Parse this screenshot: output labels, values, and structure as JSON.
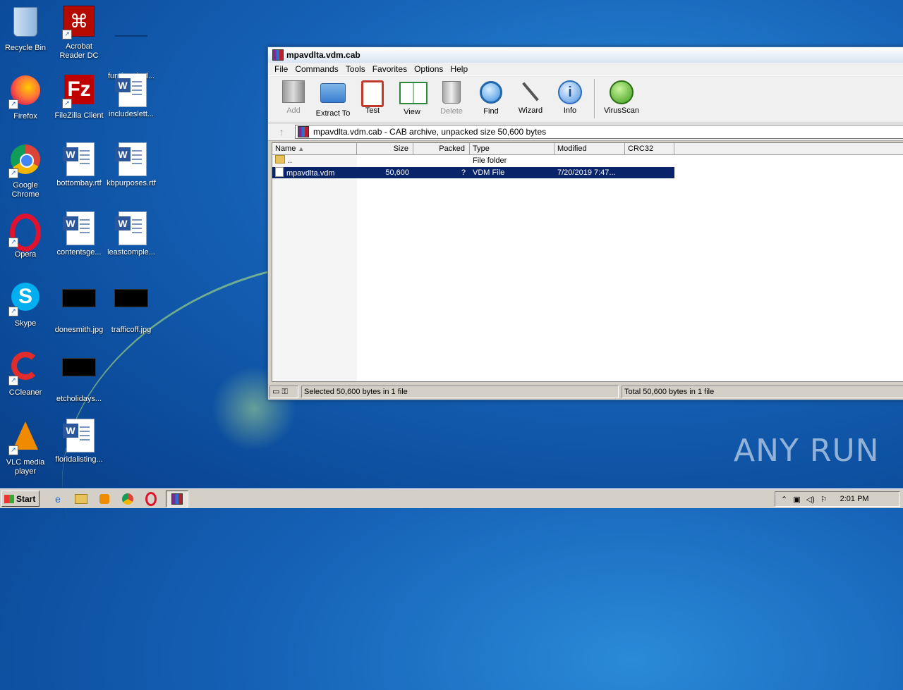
{
  "desktop": {
    "icons": [
      {
        "label": "Recycle Bin"
      },
      {
        "label": "Acrobat Reader DC"
      },
      {
        "label": "furnitureincl..."
      },
      {
        "label": "Firefox"
      },
      {
        "label": "FileZilla Client"
      },
      {
        "label": "includeslett..."
      },
      {
        "label": "Google Chrome"
      },
      {
        "label": "bottombay.rtf"
      },
      {
        "label": "kbpurposes.rtf"
      },
      {
        "label": "Opera"
      },
      {
        "label": "contentsge..."
      },
      {
        "label": "leastcomple..."
      },
      {
        "label": "Skype"
      },
      {
        "label": "donesmith.jpg"
      },
      {
        "label": "trafficoff.jpg"
      },
      {
        "label": "CCleaner"
      },
      {
        "label": "etcholidays..."
      },
      {
        "label": "VLC media player"
      },
      {
        "label": "floridalisting..."
      }
    ]
  },
  "window": {
    "title": "mpavdlta.vdm.cab",
    "menu": [
      "File",
      "Commands",
      "Tools",
      "Favorites",
      "Options",
      "Help"
    ],
    "toolbar": [
      {
        "label": "Add",
        "enabled": false
      },
      {
        "label": "Extract To",
        "enabled": true
      },
      {
        "label": "Test",
        "enabled": true
      },
      {
        "label": "View",
        "enabled": true
      },
      {
        "label": "Delete",
        "enabled": false
      },
      {
        "label": "Find",
        "enabled": true
      },
      {
        "label": "Wizard",
        "enabled": true
      },
      {
        "label": "Info",
        "enabled": true
      },
      {
        "label": "VirusScan",
        "enabled": true
      }
    ],
    "path": "mpavdlta.vdm.cab - CAB archive, unpacked size 50,600 bytes",
    "columns": [
      "Name",
      "Size",
      "Packed",
      "Type",
      "Modified",
      "CRC32"
    ],
    "rows": [
      {
        "name": "..",
        "size": "",
        "packed": "",
        "type": "File folder",
        "modified": "",
        "crc": ""
      },
      {
        "name": "mpavdlta.vdm",
        "size": "50,600",
        "packed": "?",
        "type": "VDM File",
        "modified": "7/20/2019 7:47...",
        "crc": ""
      }
    ],
    "status_left": "Selected 50,600 bytes in 1 file",
    "status_right": "Total 50,600 bytes in 1 file"
  },
  "taskbar": {
    "start_label": "Start",
    "clock": "2:01 PM"
  },
  "watermark": "ANY RUN"
}
